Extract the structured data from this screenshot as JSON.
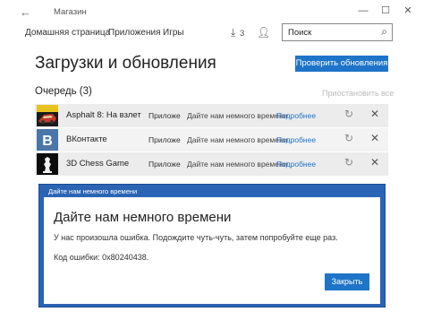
{
  "window": {
    "title": "Магазин",
    "back_glyph": "←",
    "minimize_glyph": "—",
    "maximize_glyph": "☐",
    "close_glyph": "✕"
  },
  "nav": {
    "home": "Домашняя страница",
    "apps": "Приложения",
    "games": "Игры",
    "downloads_count": "3",
    "search_value": "Поиск"
  },
  "page": {
    "title": "Загрузки и обновления",
    "check_updates": "Проверить обновления",
    "queue_title": "Очередь (3)",
    "pause_all": "Приостановить все"
  },
  "queue": [
    {
      "name": "Asphalt 8: На взлет",
      "type": "Приложе",
      "status": "Дайте нам немного времени",
      "link": "Подробнее",
      "icon": "asphalt-app-icon"
    },
    {
      "name": "ВКонтакте",
      "type": "Приложе",
      "status": "Дайте нам немного времени",
      "link": "Подробнее",
      "icon": "vk-app-icon"
    },
    {
      "name": "3D Chess Game",
      "type": "Приложе",
      "status": "Дайте нам немного времени",
      "link": "Подробнее",
      "icon": "chess-app-icon"
    }
  ],
  "dialog": {
    "title": "Дайте нам немного времени",
    "heading": "Дайте нам немного времени",
    "message": "У нас произошла ошибка. Подождите чуть-чуть, затем попробуйте еще раз.",
    "code": "Код ошибки: 0x80240438.",
    "close_label": "Закрыть"
  },
  "colors": {
    "accent": "#1e74c8",
    "dialog_border": "#2b64b5"
  }
}
